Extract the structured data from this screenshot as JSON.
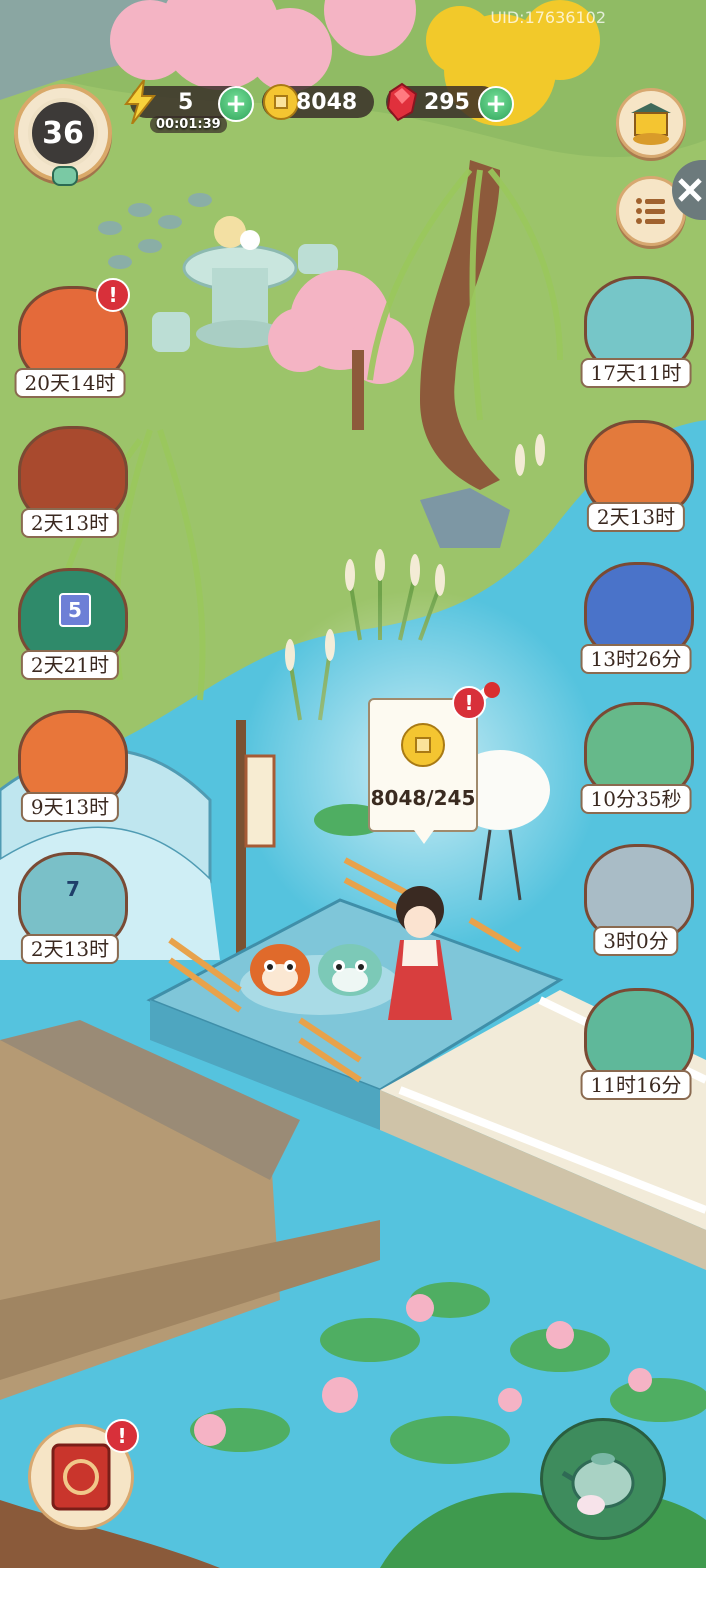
{
  "hud": {
    "uid": "UID:17636102",
    "level": "36",
    "energy": {
      "value": "5",
      "timer": "00:01:39"
    },
    "coins": {
      "value": "8048"
    },
    "gems": {
      "value": "295"
    }
  },
  "left_events": [
    {
      "label": "20天14时",
      "alert": "!"
    },
    {
      "label": "2天13时"
    },
    {
      "label": "2天21时",
      "badge": "5"
    },
    {
      "label": "9天13时"
    },
    {
      "label": "2天13时",
      "badge": "7"
    }
  ],
  "right_events": [
    {
      "label": "17天11时"
    },
    {
      "label": "2天13时"
    },
    {
      "label": "13时26分"
    },
    {
      "label": "10分35秒"
    },
    {
      "label": "3时0分"
    },
    {
      "label": "11时16分"
    }
  ],
  "coin_bubble": {
    "text": "8048/245",
    "alert": "!"
  },
  "bottom": {
    "journal_alert": "!"
  },
  "colors": {
    "grass": "#9cc46a",
    "water": "#58c7df",
    "hud_dark": "#362a26",
    "plus_green": "#3dbb6b",
    "alert_red": "#d8303a"
  },
  "icons": [
    "lightning-icon",
    "coin-icon",
    "gem-icon",
    "plus-icon",
    "shop-icon",
    "menu-icon",
    "journal-icon",
    "teapot-icon"
  ]
}
